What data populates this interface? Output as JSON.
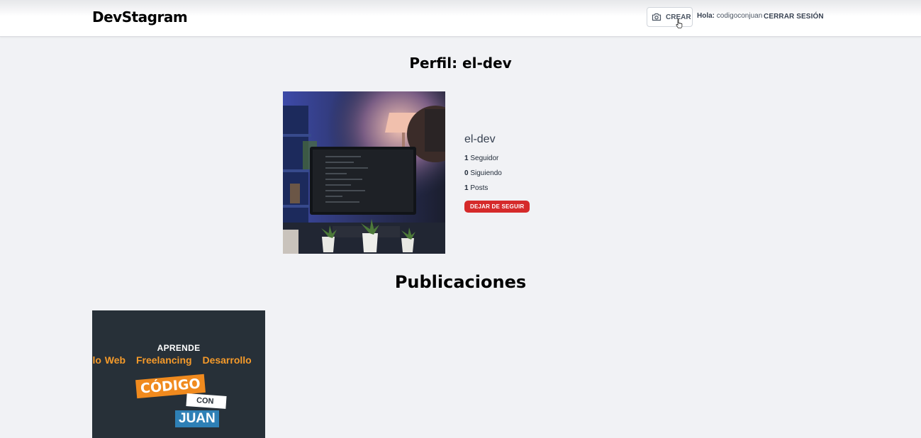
{
  "header": {
    "logo": "DevStagram",
    "create_label": "CREAR",
    "greeting_label": "Hola:",
    "username": "codigoconjuan",
    "logout_label": "CERRAR SESIÓN"
  },
  "profile": {
    "title": "Perfil: el-dev",
    "username": "el-dev",
    "followers_count": "1",
    "followers_label": "Seguidor",
    "following_count": "0",
    "following_label": "Siguiendo",
    "posts_count": "1",
    "posts_label": "Posts",
    "unfollow_label": "DEJAR DE SEGUIR"
  },
  "publications": {
    "title": "Publicaciones",
    "posts": [
      {
        "line1": "APRENDE",
        "topics": [
          "ollo Web",
          "Freelancing",
          "Desarrollo"
        ],
        "brand_1": "CÓDIGO",
        "brand_2": "CON",
        "brand_3": "JUAN"
      }
    ]
  },
  "colors": {
    "background": "#f1f2f5",
    "unfollow_button": "#d52a2a",
    "post_background": "#273038",
    "post_accent_orange": "#f59a2a",
    "post_accent_blue": "#2e80b6"
  },
  "icons": [
    "camera-icon",
    "pointer-cursor-icon"
  ]
}
